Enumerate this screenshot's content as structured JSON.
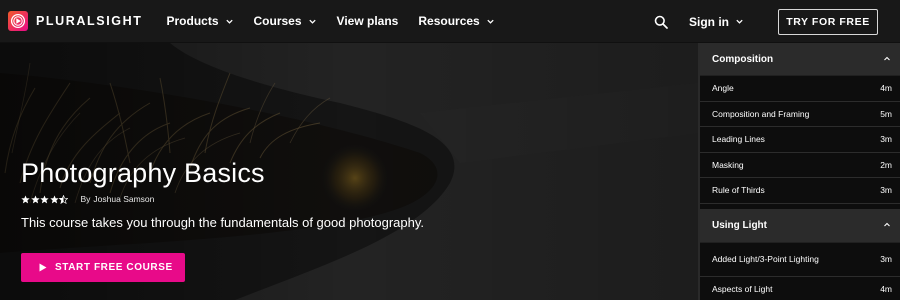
{
  "brand": {
    "name": "PLURALSIGHT",
    "accent": "#e80a89",
    "gradient_start": "#f15b2a"
  },
  "nav": {
    "links": [
      {
        "label": "Products",
        "has_dropdown": true
      },
      {
        "label": "Courses",
        "has_dropdown": true
      },
      {
        "label": "View plans",
        "has_dropdown": false
      },
      {
        "label": "Resources",
        "has_dropdown": true
      }
    ],
    "search_icon": "search-icon",
    "signin_label": "Sign in",
    "cta_label": "TRY FOR FREE"
  },
  "course": {
    "title": "Photography Basics",
    "rating": 4.5,
    "rating_max": 5,
    "author_prefix": "By",
    "author": "Joshua Samson",
    "description": "This course takes you through the fundamentals of good photography.",
    "start_label": "START FREE COURSE"
  },
  "sidebar": {
    "sections": [
      {
        "title": "Composition",
        "expanded": true,
        "clips": [
          {
            "title": "Angle",
            "duration": "4m"
          },
          {
            "title": "Composition and Framing",
            "duration": "5m"
          },
          {
            "title": "Leading Lines",
            "duration": "3m"
          },
          {
            "title": "Masking",
            "duration": "2m"
          },
          {
            "title": "Rule of Thirds",
            "duration": "3m"
          }
        ]
      },
      {
        "title": "Using Light",
        "expanded": true,
        "clips": [
          {
            "title": "Added Light/3-Point Lighting",
            "duration": "3m"
          },
          {
            "title": "Aspects of Light",
            "duration": "4m"
          }
        ]
      }
    ]
  }
}
